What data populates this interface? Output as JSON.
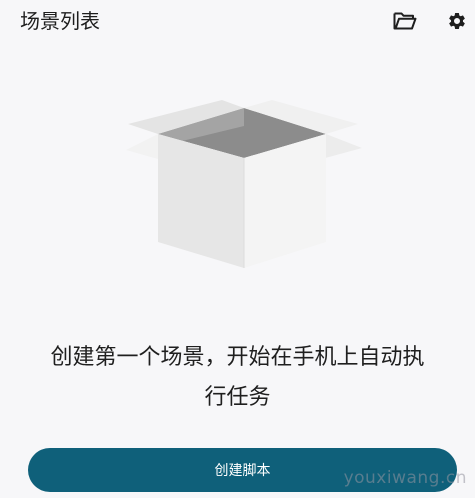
{
  "header": {
    "title": "场景列表",
    "icons": [
      "folder-open-icon",
      "gear-icon"
    ]
  },
  "empty_state": {
    "message": "创建第一个场景，开始在手机上自动执\n行任务"
  },
  "actions": {
    "create_script_label": "创建脚本"
  },
  "watermark": {
    "text": "youxiwang.cn"
  },
  "colors": {
    "primary": "#0f607a",
    "background": "#f7f7f9",
    "text": "#1e1e1e"
  }
}
